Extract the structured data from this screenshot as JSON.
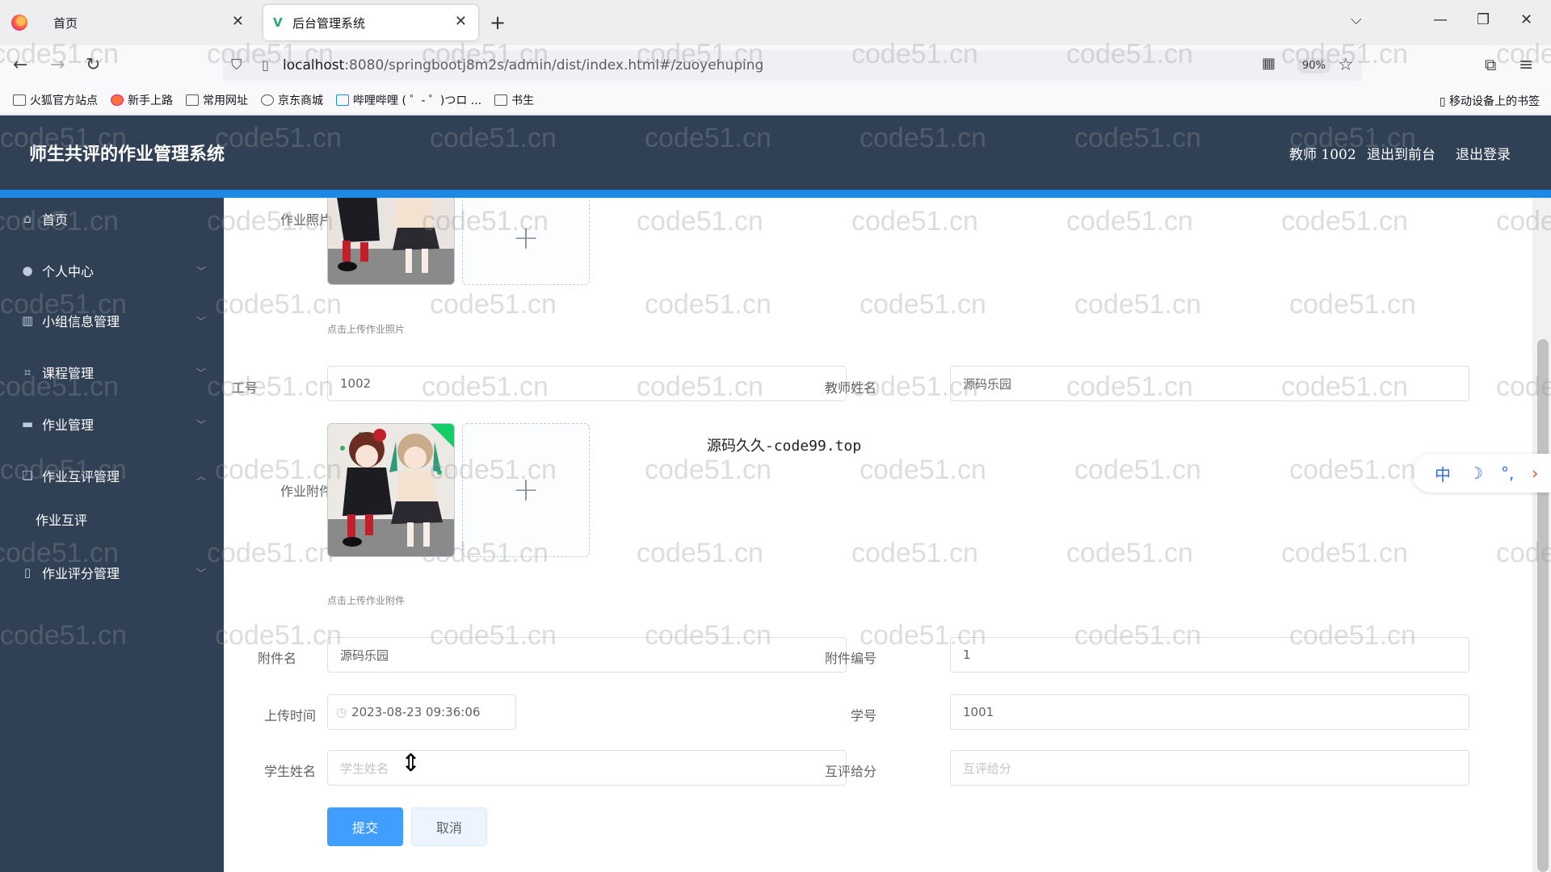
{
  "browser": {
    "tabs": [
      {
        "label": "首页"
      },
      {
        "label": "后台管理系统"
      }
    ],
    "url_host": "localhost",
    "url_rest": ":8080/springbootj8m2s/admin/dist/index.html#/zuoyehuping",
    "zoom": "90%",
    "bookmarks": [
      "火狐官方站点",
      "新手上路",
      "常用网址",
      "京东商城",
      "哔哩哔哩 ( ゜- ゜)つロ ...",
      "书生"
    ],
    "mobile_bookmarks": "移动设备上的书签"
  },
  "header": {
    "title": "师生共评的作业管理系统",
    "user": "教师 1002",
    "to_front": "退出到前台",
    "logout": "退出登录"
  },
  "sidebar": {
    "items": [
      {
        "label": "首页",
        "icon": "home-icon"
      },
      {
        "label": "个人中心",
        "icon": "user-icon"
      },
      {
        "label": "小组信息管理",
        "icon": "group-icon"
      },
      {
        "label": "课程管理",
        "icon": "course-icon"
      },
      {
        "label": "作业管理",
        "icon": "homework-icon"
      },
      {
        "label": "作业互评管理",
        "icon": "review-icon"
      },
      {
        "label": "作业互评",
        "icon": ""
      },
      {
        "label": "作业评分管理",
        "icon": "score-icon"
      }
    ]
  },
  "form": {
    "photo_label": "作业照片",
    "photo_hint": "点击上传作业照片",
    "staff_no_label": "工号",
    "staff_no_value": "1002",
    "teacher_name_label": "教师姓名",
    "teacher_name_value": "源码乐园",
    "attachment_label": "作业附件",
    "attachment_hint": "点击上传作业附件",
    "attach_name_label": "附件名",
    "attach_name_value": "源码乐园",
    "attach_no_label": "附件编号",
    "attach_no_value": "1",
    "upload_time_label": "上传时间",
    "upload_time_value": "2023-08-23 09:36:06",
    "student_no_label": "学号",
    "student_no_value": "1001",
    "student_name_label": "学生姓名",
    "student_name_placeholder": "学生姓名",
    "peer_score_label": "互评给分",
    "peer_score_placeholder": "互评给分",
    "submit": "提交",
    "cancel": "取消"
  },
  "promo_text": "源码久久-code99.top",
  "ime": {
    "lang": "中"
  },
  "watermark": "code51.cn",
  "colors": {
    "header": "#304156",
    "accent": "#1e88e5",
    "primary_button": "#409eff"
  }
}
